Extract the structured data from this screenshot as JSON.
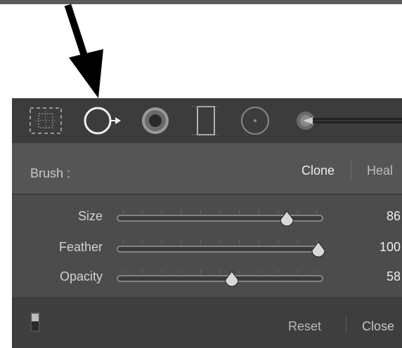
{
  "toolbar": {
    "tools": [
      {
        "icon": "crop-overlay-icon"
      },
      {
        "icon": "spot-removal-icon",
        "selected": true
      },
      {
        "icon": "red-eye-correction-icon"
      },
      {
        "icon": "graduated-filter-icon"
      },
      {
        "icon": "radial-filter-icon"
      },
      {
        "icon": "adjustment-brush-icon"
      }
    ]
  },
  "brush": {
    "label": "Brush :",
    "modes": [
      "Clone",
      "Heal"
    ],
    "active_mode": "Clone"
  },
  "sliders": [
    {
      "label": "Size",
      "value": "86",
      "fraction": 0.84
    },
    {
      "label": "Feather",
      "value": "100",
      "fraction": 1.0
    },
    {
      "label": "Opacity",
      "value": "58",
      "fraction": 0.56
    }
  ],
  "footer": {
    "reset_label": "Reset",
    "close_label": "Close"
  },
  "annotation": {
    "icon": "pointer-arrow-icon"
  }
}
